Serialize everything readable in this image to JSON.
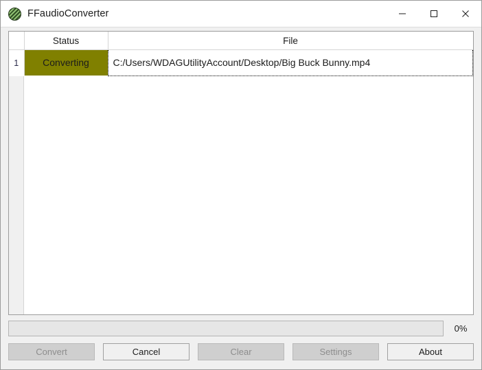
{
  "window": {
    "title": "FFaudioConverter",
    "icon": "app-logo-icon",
    "controls": {
      "minimize_label": "Minimize",
      "maximize_label": "Maximize",
      "close_label": "Close"
    }
  },
  "table": {
    "columns": [
      {
        "key": "rownum",
        "label": ""
      },
      {
        "key": "status",
        "label": "Status"
      },
      {
        "key": "file",
        "label": "File"
      }
    ],
    "rows": [
      {
        "rownum": "1",
        "status": "Converting",
        "status_bg": "#808000",
        "file": "C:/Users/WDAGUtilityAccount/Desktop/Big Buck Bunny.mp4"
      }
    ]
  },
  "progress": {
    "percent_label": "0%",
    "value": 0
  },
  "buttons": [
    {
      "name": "convert",
      "label": "Convert",
      "enabled": false
    },
    {
      "name": "cancel",
      "label": "Cancel",
      "enabled": true
    },
    {
      "name": "clear",
      "label": "Clear",
      "enabled": false
    },
    {
      "name": "settings",
      "label": "Settings",
      "enabled": false
    },
    {
      "name": "about",
      "label": "About",
      "enabled": true
    }
  ]
}
